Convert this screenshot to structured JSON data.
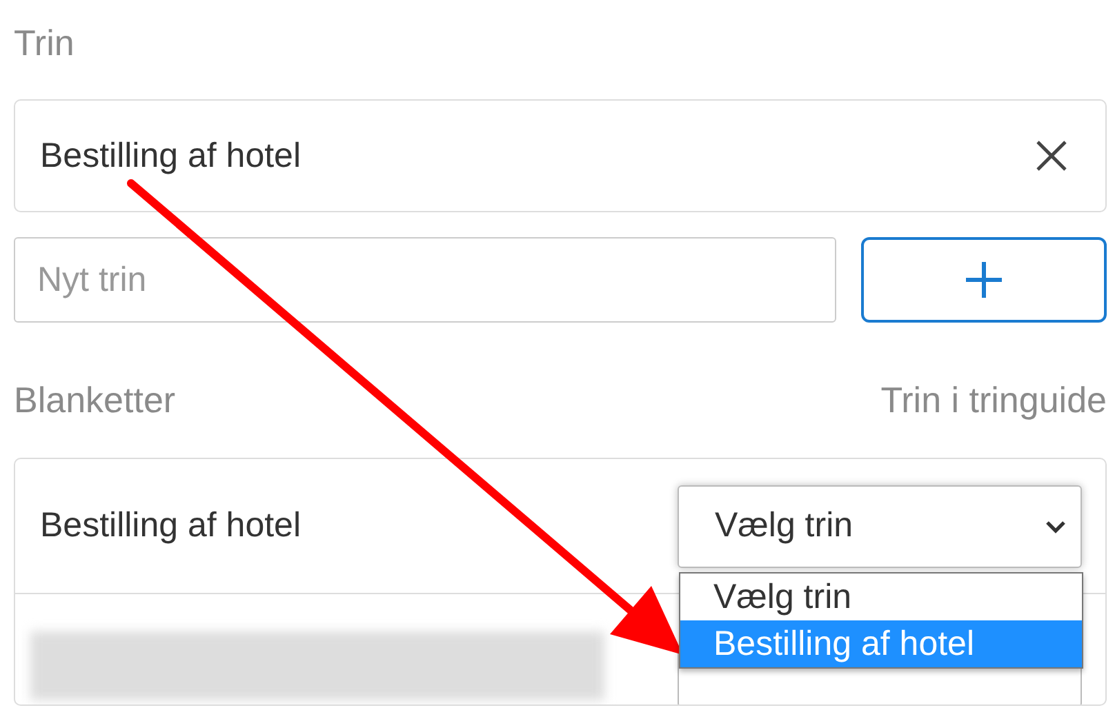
{
  "steps_section": {
    "label": "Trin"
  },
  "steps": [
    {
      "name": "Bestilling af hotel"
    }
  ],
  "new_step": {
    "placeholder": "Nyt trin"
  },
  "forms_section": {
    "label": "Blanketter",
    "column_label": "Trin i tringuide"
  },
  "forms": [
    {
      "kind": "named",
      "name": "Bestilling af hotel",
      "select": {
        "value": "Vælg trin",
        "open": true,
        "options": [
          {
            "label": "Vælg trin",
            "highlighted": false
          },
          {
            "label": "Bestilling af hotel",
            "highlighted": true
          }
        ]
      }
    },
    {
      "kind": "redacted",
      "select": {
        "open": false
      }
    }
  ]
}
